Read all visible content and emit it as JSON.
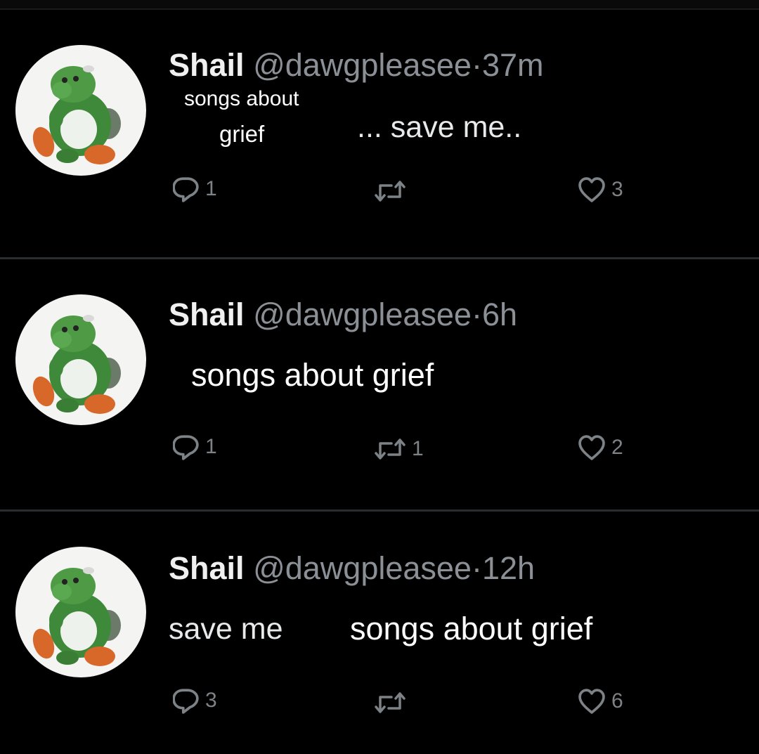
{
  "tweets": [
    {
      "name": "Shail",
      "handle": "@dawgpleasee",
      "separator": "·",
      "time": "37m",
      "body": "... save me..",
      "overlay_line1": "songs about",
      "overlay_line2": "grief",
      "replies": "1",
      "retweets": "",
      "likes": "3"
    },
    {
      "name": "Shail",
      "handle": "@dawgpleasee",
      "separator": "·",
      "time": "6h",
      "body": "",
      "overlay": "songs about grief",
      "replies": "1",
      "retweets": "1",
      "likes": "2"
    },
    {
      "name": "Shail",
      "handle": "@dawgpleasee",
      "separator": "·",
      "time": "12h",
      "body": "save me",
      "overlay": "songs about grief",
      "replies": "3",
      "retweets": "",
      "likes": "6"
    }
  ],
  "icons": {
    "reply": "speech-bubble-icon",
    "retweet": "retweet-arrows-icon",
    "like": "heart-icon",
    "avatar": "green-dinosaur-avatar"
  },
  "colors": {
    "background": "#000000",
    "text": "#e7e9ea",
    "muted": "#8b9096",
    "divider": "#2a2d30",
    "avatar_bg": "#f4f4f2",
    "dino_green": "#3f8a3a"
  }
}
